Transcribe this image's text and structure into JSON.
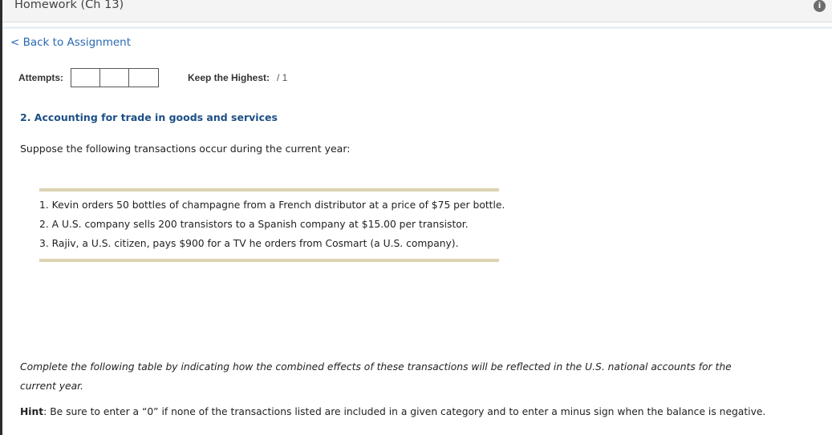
{
  "header": {
    "title": "Homework (Ch 13)",
    "info_icon": "info-icon"
  },
  "nav": {
    "back_link": "< Back to Assignment"
  },
  "attempts": {
    "label": "Attempts:",
    "boxes": 3,
    "keep_label": "Keep the Highest:",
    "keep_value": "/ 1"
  },
  "question": {
    "title": "2. Accounting for trade in goods and services",
    "intro": "Suppose the following transactions occur during the current year:",
    "transactions": [
      "1. Kevin orders 50 bottles of champagne from a French distributor at a price of $75 per bottle.",
      "2. A U.S. company sells 200 transistors to a Spanish company at $15.00 per transistor.",
      "3. Rajiv, a U.S. citizen, pays $900 for a TV he orders from Cosmart (a U.S. company)."
    ],
    "instructions": "Complete the following table by indicating how the combined effects of these transactions will be reflected in the U.S. national accounts for the current year.",
    "hint_label": "Hint",
    "hint_text": ": Be sure to enter a “0” if none of the transactions listed are included in a given category and to enter a minus sign when the balance is negative."
  },
  "colors": {
    "link": "#2a68b1",
    "title": "#1d4f86",
    "rule": "#dcd3b2"
  }
}
